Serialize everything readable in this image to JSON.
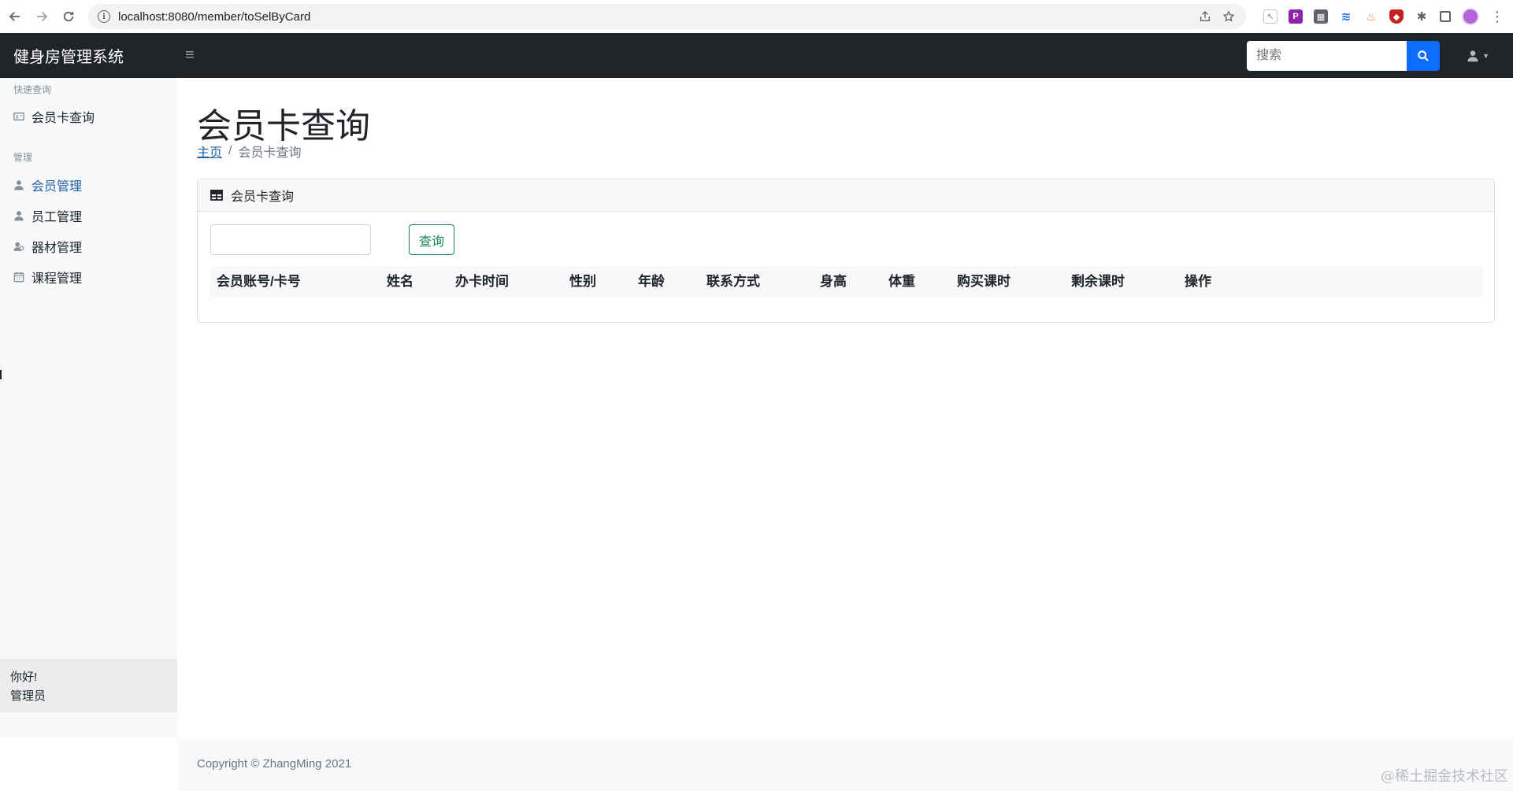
{
  "browser": {
    "url": "localhost:8080/member/toSelByCard"
  },
  "navbar": {
    "brand": "健身房管理系统",
    "toggle_icon": "≡",
    "search_placeholder": "搜索"
  },
  "sidebar": {
    "sections": [
      {
        "heading": "快速查询"
      },
      {
        "heading": "管理"
      }
    ],
    "quick_items": [
      {
        "label": "会员卡查询",
        "icon": "id-card-icon"
      }
    ],
    "manage_items": [
      {
        "label": "会员管理",
        "icon": "user-icon"
      },
      {
        "label": "员工管理",
        "icon": "user-icon"
      },
      {
        "label": "器材管理",
        "icon": "equipment-icon"
      },
      {
        "label": "课程管理",
        "icon": "calendar-icon"
      }
    ],
    "footer_greeting": "你好!",
    "footer_role": "管理员"
  },
  "main": {
    "title": "会员卡查询",
    "breadcrumb": {
      "home": "主页",
      "separator": "/",
      "current": "会员卡查询"
    },
    "card": {
      "header": "会员卡查询",
      "query_button": "查询",
      "columns": [
        "会员账号/卡号",
        "姓名",
        "办卡时间",
        "性别",
        "年龄",
        "联系方式",
        "身高",
        "体重",
        "购买课时",
        "剩余课时",
        "操作"
      ]
    }
  },
  "footer": {
    "copyright": "Copyright © ZhangMing 2021",
    "watermark": "@稀土掘金技术社区"
  },
  "colors": {
    "navbar_bg": "#212529",
    "primary": "#0d6efd",
    "success": "#198754",
    "active_link": "#1f5fa8"
  }
}
